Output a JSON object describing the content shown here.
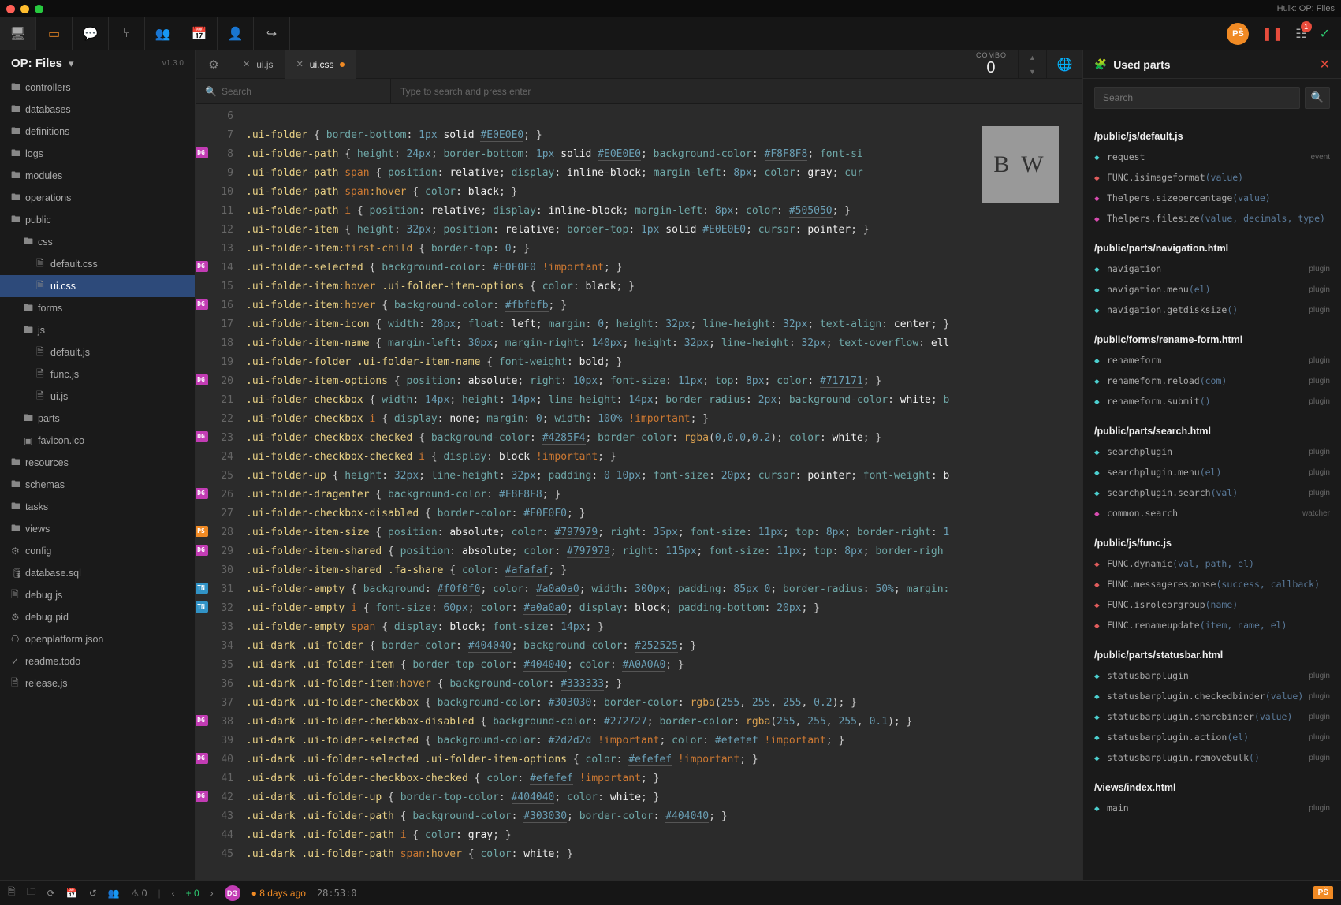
{
  "window_title": "Hulk: OP: Files",
  "sidebar": {
    "title": "OP: Files",
    "version": "v1.3.0",
    "search_placeholder": "Search",
    "items": [
      {
        "label": "controllers",
        "type": "folder",
        "depth": 0
      },
      {
        "label": "databases",
        "type": "folder",
        "depth": 0
      },
      {
        "label": "definitions",
        "type": "folder",
        "depth": 0
      },
      {
        "label": "logs",
        "type": "folder",
        "depth": 0
      },
      {
        "label": "modules",
        "type": "folder",
        "depth": 0
      },
      {
        "label": "operations",
        "type": "folder",
        "depth": 0
      },
      {
        "label": "public",
        "type": "folder",
        "depth": 0,
        "open": true
      },
      {
        "label": "css",
        "type": "folder",
        "depth": 1,
        "open": true
      },
      {
        "label": "default.css",
        "type": "file",
        "depth": 2
      },
      {
        "label": "ui.css",
        "type": "file",
        "depth": 2,
        "sel": true
      },
      {
        "label": "forms",
        "type": "folder",
        "depth": 1
      },
      {
        "label": "js",
        "type": "folder",
        "depth": 1,
        "open": true
      },
      {
        "label": "default.js",
        "type": "file",
        "depth": 2
      },
      {
        "label": "func.js",
        "type": "file",
        "depth": 2
      },
      {
        "label": "ui.js",
        "type": "file",
        "depth": 2
      },
      {
        "label": "parts",
        "type": "folder",
        "depth": 1
      },
      {
        "label": "favicon.ico",
        "type": "file-img",
        "depth": 1
      },
      {
        "label": "resources",
        "type": "folder",
        "depth": 0
      },
      {
        "label": "schemas",
        "type": "folder",
        "depth": 0
      },
      {
        "label": "tasks",
        "type": "folder",
        "depth": 0
      },
      {
        "label": "views",
        "type": "folder",
        "depth": 0
      },
      {
        "label": "config",
        "type": "file-cfg",
        "depth": 0
      },
      {
        "label": "database.sql",
        "type": "file-db",
        "depth": 0
      },
      {
        "label": "debug.js",
        "type": "file",
        "depth": 0
      },
      {
        "label": "debug.pid",
        "type": "file-cfg",
        "depth": 0
      },
      {
        "label": "openplatform.json",
        "type": "file-json",
        "depth": 0
      },
      {
        "label": "readme.todo",
        "type": "file-todo",
        "depth": 0
      },
      {
        "label": "release.js",
        "type": "file",
        "depth": 0
      }
    ]
  },
  "tabs": [
    {
      "label": "ui.js",
      "active": false
    },
    {
      "label": "ui.css",
      "active": true,
      "dirty": true
    }
  ],
  "combo": {
    "label": "COMBO",
    "value": "0"
  },
  "subheader": {
    "search": "Search",
    "type": "Type to search and press enter"
  },
  "gutter": [
    {
      "n": 6
    },
    {
      "n": 7
    },
    {
      "n": 8,
      "av": "DG"
    },
    {
      "n": 9
    },
    {
      "n": 10
    },
    {
      "n": 11
    },
    {
      "n": 12
    },
    {
      "n": 13
    },
    {
      "n": 14,
      "av": "DG"
    },
    {
      "n": 15
    },
    {
      "n": 16,
      "av": "DG"
    },
    {
      "n": 17
    },
    {
      "n": 18
    },
    {
      "n": 19
    },
    {
      "n": 20,
      "av": "DG"
    },
    {
      "n": 21
    },
    {
      "n": 22
    },
    {
      "n": 23,
      "av": "DG"
    },
    {
      "n": 24
    },
    {
      "n": 25
    },
    {
      "n": 26,
      "av": "DG"
    },
    {
      "n": 27
    },
    {
      "n": 28,
      "av": "PS"
    },
    {
      "n": 29,
      "av": "DG"
    },
    {
      "n": 30
    },
    {
      "n": 31,
      "av": "TN"
    },
    {
      "n": 32,
      "av": "TN"
    },
    {
      "n": 33
    },
    {
      "n": 34
    },
    {
      "n": 35
    },
    {
      "n": 36
    },
    {
      "n": 37
    },
    {
      "n": 38,
      "av": "DG"
    },
    {
      "n": 39
    },
    {
      "n": 40,
      "av": "DG"
    },
    {
      "n": 41
    },
    {
      "n": 42,
      "av": "DG"
    },
    {
      "n": 43
    },
    {
      "n": 44
    },
    {
      "n": 45
    }
  ],
  "code": [
    "",
    "<sel>.ui-folder</sel> { <prop>border-bottom</prop>: <num>1px</num> <wht>solid</wht> <col>#E0E0E0</col>; }",
    "<sel>.ui-folder-path</sel> { <prop>height</prop>: <num>24px</num>; <prop>border-bottom</prop>: <num>1px</num> <wht>solid</wht> <col>#E0E0E0</col>; <prop>background-color</prop>: <col>#F8F8F8</col>; <prop>font-si</prop>",
    "<sel>.ui-folder-path</sel> <key>span</key> { <prop>position</prop>: <wht>relative</wht>; <prop>display</prop>: <wht>inline-block</wht>; <prop>margin-left</prop>: <num>8px</num>; <prop>color</prop>: <wht>gray</wht>; <prop>cur</prop>",
    "<sel>.ui-folder-path</sel> <key>span</key><fn>:hover</fn> { <prop>color</prop>: <wht>black</wht>; }",
    "<sel>.ui-folder-path</sel> <key>i</key> { <prop>position</prop>: <wht>relative</wht>; <prop>display</prop>: <wht>inline-block</wht>; <prop>margin-left</prop>: <num>8px</num>; <prop>color</prop>: <col>#505050</col>; }",
    "<sel>.ui-folder-item</sel> { <prop>height</prop>: <num>32px</num>; <prop>position</prop>: <wht>relative</wht>; <prop>border-top</prop>: <num>1px</num> <wht>solid</wht> <col>#E0E0E0</col>; <prop>cursor</prop>: <wht>pointer</wht>; }",
    "<sel>.ui-folder-item</sel><fn>:first-child</fn> { <prop>border-top</prop>: <num>0</num>; }",
    "<sel>.ui-folder-selected</sel> { <prop>background-color</prop>: <col>#F0F0F0</col> <imp>!important</imp>; }",
    "<sel>.ui-folder-item</sel><fn>:hover</fn> <sel>.ui-folder-item-options</sel> { <prop>color</prop>: <wht>black</wht>; }",
    "<sel>.ui-folder-item</sel><fn>:hover</fn> { <prop>background-color</prop>: <col>#fbfbfb</col>; }",
    "<sel>.ui-folder-item-icon</sel> { <prop>width</prop>: <num>28px</num>; <prop>float</prop>: <wht>left</wht>; <prop>margin</prop>: <num>0</num>; <prop>height</prop>: <num>32px</num>; <prop>line-height</prop>: <num>32px</num>; <prop>text-align</prop>: <wht>center</wht>; }",
    "<sel>.ui-folder-item-name</sel> { <prop>margin-left</prop>: <num>30px</num>; <prop>margin-right</prop>: <num>140px</num>; <prop>height</prop>: <num>32px</num>; <prop>line-height</prop>: <num>32px</num>; <prop>text-overflow</prop>: <wht>ell</wht>",
    "<sel>.ui-folder-folder</sel> <sel>.ui-folder-item-name</sel> { <prop>font-weight</prop>: <wht>bold</wht>; }",
    "<sel>.ui-folder-item-options</sel> { <prop>position</prop>: <wht>absolute</wht>; <prop>right</prop>: <num>10px</num>; <prop>font-size</prop>: <num>11px</num>; <prop>top</prop>: <num>8px</num>; <prop>color</prop>: <col>#717171</col>; }",
    "<sel>.ui-folder-checkbox</sel> { <prop>width</prop>: <num>14px</num>; <prop>height</prop>: <num>14px</num>; <prop>line-height</prop>: <num>14px</num>; <prop>border-radius</prop>: <num>2px</num>; <prop>background-color</prop>: <wht>white</wht>; <prop>b</prop>",
    "<sel>.ui-folder-checkbox</sel> <key>i</key> { <prop>display</prop>: <wht>none</wht>; <prop>margin</prop>: <num>0</num>; <prop>width</prop>: <num>100%</num> <imp>!important</imp>; }",
    "<sel>.ui-folder-checkbox-checked</sel> { <prop>background-color</prop>: <col>#4285F4</col>; <prop>border-color</prop>: <fn>rgba</fn>(<num>0</num>,<num>0</num>,<num>0</num>,<num>0.2</num>); <prop>color</prop>: <wht>white</wht>; }",
    "<sel>.ui-folder-checkbox-checked</sel> <key>i</key> { <prop>display</prop>: <wht>block</wht> <imp>!important</imp>; }",
    "<sel>.ui-folder-up</sel> { <prop>height</prop>: <num>32px</num>; <prop>line-height</prop>: <num>32px</num>; <prop>padding</prop>: <num>0</num> <num>10px</num>; <prop>font-size</prop>: <num>20px</num>; <prop>cursor</prop>: <wht>pointer</wht>; <prop>font-weight</prop>: <wht>b</wht>",
    "<sel>.ui-folder-dragenter</sel> { <prop>background-color</prop>: <col>#F8F8F8</col>; }",
    "<sel>.ui-folder-checkbox-disabled</sel> { <prop>border-color</prop>: <col>#F0F0F0</col>; }",
    "<sel>.ui-folder-item-size</sel> { <prop>position</prop>: <wht>absolute</wht>; <prop>color</prop>: <col>#797979</col>; <prop>right</prop>: <num>35px</num>; <prop>font-size</prop>: <num>11px</num>; <prop>top</prop>: <num>8px</num>; <prop>border-right</prop>: <num>1</num>",
    "<sel>.ui-folder-item-shared</sel> { <prop>position</prop>: <wht>absolute</wht>; <prop>color</prop>: <col>#797979</col>; <prop>right</prop>: <num>115px</num>; <prop>font-size</prop>: <num>11px</num>; <prop>top</prop>: <num>8px</num>; <prop>border-righ</prop>",
    "<sel>.ui-folder-item-shared</sel> <sel>.fa-share</sel> { <prop>color</prop>: <col>#afafaf</col>; }",
    "<sel>.ui-folder-empty</sel> { <prop>background</prop>: <col>#f0f0f0</col>; <prop>color</prop>: <col>#a0a0a0</col>; <prop>width</prop>: <num>300px</num>; <prop>padding</prop>: <num>85px</num> <num>0</num>; <prop>border-radius</prop>: <num>50%</num>; <prop>margin:</prop>",
    "<sel>.ui-folder-empty</sel> <key>i</key> { <prop>font-size</prop>: <num>60px</num>; <prop>color</prop>: <col>#a0a0a0</col>; <prop>display</prop>: <wht>block</wht>; <prop>padding-bottom</prop>: <num>20px</num>; }",
    "<sel>.ui-folder-empty</sel> <key>span</key> { <prop>display</prop>: <wht>block</wht>; <prop>font-size</prop>: <num>14px</num>; }",
    "<sel>.ui-dark</sel> <sel>.ui-folder</sel> { <prop>border-color</prop>: <col>#404040</col>; <prop>background-color</prop>: <col>#252525</col>; }",
    "<sel>.ui-dark</sel> <sel>.ui-folder-item</sel> { <prop>border-top-color</prop>: <col>#404040</col>; <prop>color</prop>: <col>#A0A0A0</col>; }",
    "<sel>.ui-dark</sel> <sel>.ui-folder-item</sel><fn>:hover</fn> { <prop>background-color</prop>: <col>#333333</col>; }",
    "<sel>.ui-dark</sel> <sel>.ui-folder-checkbox</sel> { <prop>background-color</prop>: <col>#303030</col>; <prop>border-color</prop>: <fn>rgba</fn>(<num>255</num>, <num>255</num>, <num>255</num>, <num>0.2</num>); }",
    "<sel>.ui-dark</sel> <sel>.ui-folder-checkbox-disabled</sel> { <prop>background-color</prop>: <col>#272727</col>; <prop>border-color</prop>: <fn>rgba</fn>(<num>255</num>, <num>255</num>, <num>255</num>, <num>0.1</num>); }",
    "<sel>.ui-dark</sel> <sel>.ui-folder-selected</sel> { <prop>background-color</prop>: <col>#2d2d2d</col> <imp>!important</imp>; <prop>color</prop>: <col>#efefef</col> <imp>!important</imp>; }",
    "<sel>.ui-dark</sel> <sel>.ui-folder-selected</sel> <sel>.ui-folder-item-options</sel> { <prop>color</prop>: <col>#efefef</col> <imp>!important</imp>; }",
    "<sel>.ui-dark</sel> <sel>.ui-folder-checkbox-checked</sel> { <prop>color</prop>: <col>#efefef</col> <imp>!important</imp>; }",
    "<sel>.ui-dark</sel> <sel>.ui-folder-up</sel> { <prop>border-top-color</prop>: <col>#404040</col>; <prop>color</prop>: <wht>white</wht>; }",
    "<sel>.ui-dark</sel> <sel>.ui-folder-path</sel> { <prop>background-color</prop>: <col>#303030</col>; <prop>border-color</prop>: <col>#404040</col>; }",
    "<sel>.ui-dark</sel> <sel>.ui-folder-path</sel> <key>i</key> { <prop>color</prop>: <wht>gray</wht>; }",
    "<sel>.ui-dark</sel> <sel>.ui-folder-path</sel> <key>span</key><fn>:hover</fn> { <prop>color</prop>: <wht>white</wht>; }"
  ],
  "rightpanel": {
    "title": "Used parts",
    "search_placeholder": "Search",
    "groups": [
      {
        "path": "/public/js/default.js",
        "items": [
          {
            "ico": "c1",
            "name": "request",
            "args": "",
            "tag": "event"
          },
          {
            "ico": "c3",
            "name": "FUNC.isimageformat",
            "args": "(value)",
            "tag": ""
          },
          {
            "ico": "c2",
            "name": "Thelpers.sizepercentage",
            "args": "(value)",
            "tag": ""
          },
          {
            "ico": "c2",
            "name": "Thelpers.filesize",
            "args": "(value, decimals, type)",
            "tag": ""
          }
        ]
      },
      {
        "path": "/public/parts/navigation.html",
        "items": [
          {
            "ico": "c1",
            "name": "navigation",
            "args": "",
            "tag": "plugin"
          },
          {
            "ico": "c1",
            "name": "navigation.menu",
            "args": "(el)",
            "tag": "plugin"
          },
          {
            "ico": "c1",
            "name": "navigation.getdisksize",
            "args": "()",
            "tag": "plugin"
          }
        ]
      },
      {
        "path": "/public/forms/rename-form.html",
        "items": [
          {
            "ico": "c1",
            "name": "renameform",
            "args": "",
            "tag": "plugin"
          },
          {
            "ico": "c1",
            "name": "renameform.reload",
            "args": "(com)",
            "tag": "plugin"
          },
          {
            "ico": "c1",
            "name": "renameform.submit",
            "args": "()",
            "tag": "plugin"
          }
        ]
      },
      {
        "path": "/public/parts/search.html",
        "items": [
          {
            "ico": "c1",
            "name": "searchplugin",
            "args": "",
            "tag": "plugin"
          },
          {
            "ico": "c1",
            "name": "searchplugin.menu",
            "args": "(el)",
            "tag": "plugin"
          },
          {
            "ico": "c1",
            "name": "searchplugin.search",
            "args": "(val)",
            "tag": "plugin"
          },
          {
            "ico": "c2",
            "name": "common.search",
            "args": "",
            "tag": "watcher"
          }
        ]
      },
      {
        "path": "/public/js/func.js",
        "items": [
          {
            "ico": "c3",
            "name": "FUNC.dynamic",
            "args": "(val, path, el)",
            "tag": ""
          },
          {
            "ico": "c3",
            "name": "FUNC.messageresponse",
            "args": "(success, callback)",
            "tag": ""
          },
          {
            "ico": "c3",
            "name": "FUNC.isroleorgroup",
            "args": "(name)",
            "tag": ""
          },
          {
            "ico": "c3",
            "name": "FUNC.renameupdate",
            "args": "(item, name, el)",
            "tag": ""
          }
        ]
      },
      {
        "path": "/public/parts/statusbar.html",
        "items": [
          {
            "ico": "c1",
            "name": "statusbarplugin",
            "args": "",
            "tag": "plugin"
          },
          {
            "ico": "c1",
            "name": "statusbarplugin.checkedbinder",
            "args": "(value)",
            "tag": "plugin"
          },
          {
            "ico": "c1",
            "name": "statusbarplugin.sharebinder",
            "args": "(value)",
            "tag": "plugin"
          },
          {
            "ico": "c1",
            "name": "statusbarplugin.action",
            "args": "(el)",
            "tag": "plugin"
          },
          {
            "ico": "c1",
            "name": "statusbarplugin.removebulk",
            "args": "()",
            "tag": "plugin"
          }
        ]
      },
      {
        "path": "/views/index.html",
        "items": [
          {
            "ico": "c1",
            "name": "main",
            "args": "",
            "tag": "plugin"
          }
        ]
      }
    ]
  },
  "statusbar": {
    "warnings": "0",
    "plus": "0",
    "ago": "8 days ago",
    "time": "28:53:0",
    "pill": "PŠ"
  },
  "avatar": "PŠ",
  "notif_count": "1"
}
